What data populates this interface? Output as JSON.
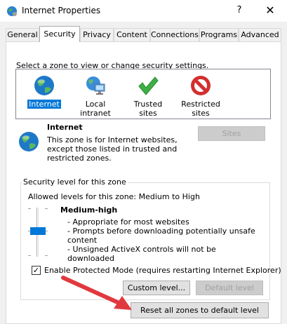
{
  "window": {
    "title": "Internet Properties",
    "help_label": "?",
    "close_label": "✕"
  },
  "tabs": [
    {
      "label": "General"
    },
    {
      "label": "Security"
    },
    {
      "label": "Privacy"
    },
    {
      "label": "Content"
    },
    {
      "label": "Connections"
    },
    {
      "label": "Programs"
    },
    {
      "label": "Advanced"
    }
  ],
  "security": {
    "zone_prompt": "Select a zone to view or change security settings.",
    "zones": [
      {
        "label": "Internet",
        "icon": "globe-icon"
      },
      {
        "label": "Local intranet",
        "icon": "network-computer-icon"
      },
      {
        "label": "Trusted sites",
        "icon": "checkmark-icon"
      },
      {
        "label_line1": "Restricted",
        "label_line2": "sites",
        "icon": "no-entry-icon"
      }
    ],
    "selected_zone": "Internet",
    "description": {
      "title": "Internet",
      "text": "This zone is for Internet websites, except those listed in trusted and restricted zones."
    },
    "sites_button": "Sites",
    "level_group": {
      "caption": "Security level for this zone",
      "allowed": "Allowed levels for this zone: Medium to High",
      "level_name": "Medium-high",
      "bullets": [
        "- Appropriate for most websites",
        "- Prompts before downloading potentially unsafe content",
        "- Unsigned ActiveX controls will not be downloaded"
      ]
    },
    "protected_mode": {
      "label": "Enable Protected Mode (requires restarting Internet Explorer)",
      "checked": true,
      "check_glyph": "✓"
    },
    "custom_level_button": "Custom level...",
    "default_level_button": "Default level",
    "reset_all_button": "Reset all zones to default level"
  },
  "colors": {
    "selection": "#0078d7",
    "arrow": "#e0393e"
  }
}
